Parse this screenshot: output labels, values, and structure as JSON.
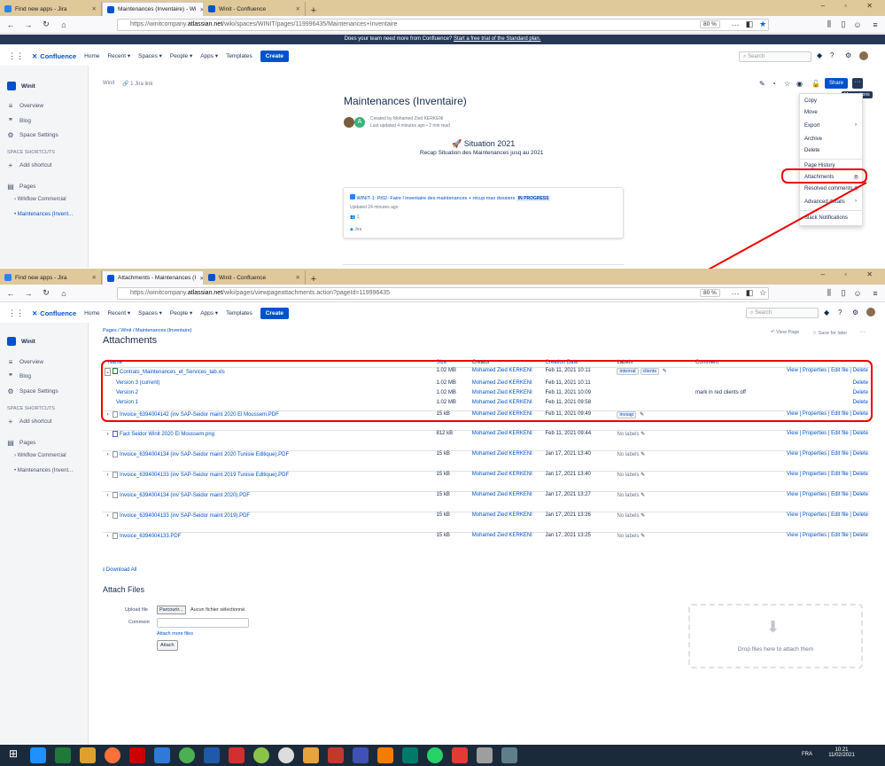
{
  "top_window": {
    "tabs": [
      {
        "label": "Find new apps - Jira",
        "color": "#2684ff"
      },
      {
        "label": "Maintenances (Inventaire) - Wi",
        "color": "#0052cc"
      },
      {
        "label": "Winit - Confluence",
        "color": "#0052cc"
      }
    ],
    "url_prefix": "https://winitcompany.",
    "url_domain": "atlassian.net",
    "url_path": "/wiki/spaces/WINIT/pages/119996435/Maintenances+Inventaire",
    "zoom": "80 %",
    "trial_banner": "Does your team need more from Confluence?",
    "trial_link": "Start a free trial of the Standard plan.",
    "nav": {
      "logo": "Confluence",
      "items": [
        "Home",
        "Recent ▾",
        "Spaces ▾",
        "People ▾",
        "Apps ▾",
        "Templates"
      ],
      "create": "Create",
      "search_placeholder": "Search"
    },
    "sidebar": {
      "space": "Winit",
      "overview": "Overview",
      "blog": "Blog",
      "space_settings": "Space Settings",
      "shortcuts_heading": "SPACE SHORTCUTS",
      "add_shortcut": "Add shortcut",
      "pages": "Pages",
      "tree": [
        "Wrkflow Commercial",
        "Maintenances (Invent..."
      ]
    },
    "breadcrumb": "Winit",
    "jira_link": "1 Jira link",
    "page_title": "Maintenances (Inventaire)",
    "created_by": "Created by Mohamed Zied KERKENI",
    "last_updated": "Last updated 4 minutes ago • 2 min read",
    "situation_title": "Situation 2021",
    "situation_sub": "Recap Situation des Maintenances jusq au 2021",
    "jira_card": {
      "issue": "WINIT-1: Pt02- Faire l inventaire des maintenances + récup max dossiers",
      "status": "IN PROGRESS",
      "updated": "Updated 24 minutes ago",
      "count": "1",
      "source": "Jira"
    },
    "share": "Share",
    "more_actions_tooltip": "More actions",
    "menu": [
      "Copy",
      "Move",
      "Export",
      "Archive",
      "Delete",
      "Page History",
      "Attachments",
      "Resolved comments",
      "Advanced details",
      "Slack Notifications"
    ],
    "attachments_count": "8",
    "resolved_count": "0"
  },
  "bottom_window": {
    "tabs": [
      {
        "label": "Find new apps - Jira",
        "color": "#2684ff"
      },
      {
        "label": "Attachments - Maintenances (I",
        "color": "#0052cc"
      },
      {
        "label": "Winit - Confluence",
        "color": "#0052cc"
      }
    ],
    "url_prefix": "https://winitcompany.",
    "url_domain": "atlassian.net",
    "url_path": "/wiki/pages/viewpageattachments.action?pageId=119996435",
    "zoom": "80 %",
    "breadcrumb": [
      "Pages",
      "Winit",
      "Maintenances (Inventaire)"
    ],
    "title": "Attachments",
    "view_page": "View Page",
    "save_later": "Save for later",
    "columns": [
      "Name",
      "Size",
      "Creator",
      "Creation Date",
      "Labels",
      "Comment"
    ],
    "rows": [
      {
        "name": "Contrats_Maintenances_et_Services_tab.xls",
        "size": "1.02 MB",
        "creator": "Mohamed Zied KERKENI",
        "date": "Feb 11, 2021 10:11",
        "labels": [
          "internal",
          "clients"
        ],
        "comment": "",
        "actions": "View | Properties | Edit file | Delete",
        "type": "xls",
        "expanded": true
      },
      {
        "name": "Version 3 (current)",
        "size": "1.02 MB",
        "creator": "Mohamed Zied KERKENI",
        "date": "Feb 11, 2021 10:11",
        "labels": [],
        "comment": "",
        "actions": "Delete",
        "type": "version"
      },
      {
        "name": "Version 2",
        "size": "1.02 MB",
        "creator": "Mohamed Zied KERKENI",
        "date": "Feb 11, 2021 10:09",
        "labels": [],
        "comment": "mark in red clients off",
        "actions": "Delete",
        "type": "version"
      },
      {
        "name": "Version 1",
        "size": "1.02 MB",
        "creator": "Mohamed Zied KERKENI",
        "date": "Feb 11, 2021 09:58",
        "labels": [],
        "comment": "",
        "actions": "Delete",
        "type": "version"
      },
      {
        "name": "Invoice_6394004142 (inv SAP-Seidor maint 2020 El Moussem.PDF",
        "size": "15 kB",
        "creator": "Mohamed Zied KERKENI",
        "date": "Feb 11, 2021 09:49",
        "labels": [
          "invsap"
        ],
        "comment": "",
        "actions": "View | Properties | Edit file | Delete",
        "type": "pdf"
      },
      {
        "name": "Fact Seidor Winit 2020 El Moussem.png",
        "size": "812 kB",
        "creator": "Mohamed Zied KERKENI",
        "date": "Feb 11, 2021 09:44",
        "labels": [
          "No labels"
        ],
        "comment": "",
        "actions": "View | Properties | Edit file | Delete",
        "type": "png"
      },
      {
        "name": "Invoice_6394004134 (inv SAP-Seidor maint 2020 Tunisie Editique).PDF",
        "size": "15 kB",
        "creator": "Mohamed Zied KERKENI",
        "date": "Jan 17, 2021 13:40",
        "labels": [
          "No labels"
        ],
        "comment": "",
        "actions": "View | Properties | Edit file | Delete",
        "type": "pdf"
      },
      {
        "name": "Invoice_6394004133 (inv SAP-Seidor maint 2019 Tunisie Editique).PDF",
        "size": "15 kB",
        "creator": "Mohamed Zied KERKENI",
        "date": "Jan 17, 2021 13:40",
        "labels": [
          "No labels"
        ],
        "comment": "",
        "actions": "View | Properties | Edit file | Delete",
        "type": "pdf"
      },
      {
        "name": "Invoice_6394004134 (inv SAP-Seidor maint 2020).PDF",
        "size": "15 kB",
        "creator": "Mohamed Zied KERKENI",
        "date": "Jan 17, 2021 13:27",
        "labels": [
          "No labels"
        ],
        "comment": "",
        "actions": "View | Properties | Edit file | Delete",
        "type": "pdf"
      },
      {
        "name": "Invoice_6394004133 (inv SAP-Seidor maint 2019).PDF",
        "size": "15 kB",
        "creator": "Mohamed Zied KERKENI",
        "date": "Jan 17, 2021 13:26",
        "labels": [
          "No labels"
        ],
        "comment": "",
        "actions": "View | Properties | Edit file | Delete",
        "type": "pdf"
      },
      {
        "name": "Invoice_6394004133.PDF",
        "size": "15 kB",
        "creator": "Mohamed Zied KERKENI",
        "date": "Jan 17, 2021 13:25",
        "labels": [
          "No labels"
        ],
        "comment": "",
        "actions": "View | Properties | Edit file | Delete",
        "type": "pdf"
      }
    ],
    "download_all": "Download All",
    "attach_files_heading": "Attach Files",
    "upload_file_label": "Upload file",
    "browse_button": "Parcourir...",
    "no_file": "Aucun fichier sélectionné.",
    "comment_label": "Comment",
    "attach_more": "Attach more files",
    "attach_button": "Attach",
    "drop_zone": "Drop files here to attach them"
  },
  "taskbar": {
    "language": "FRA",
    "time": "10:21",
    "date": "11/02/2021"
  },
  "colors": {
    "accent": "#0052cc",
    "highlight": "#e00000",
    "tab_strip": "#dfc89a"
  }
}
